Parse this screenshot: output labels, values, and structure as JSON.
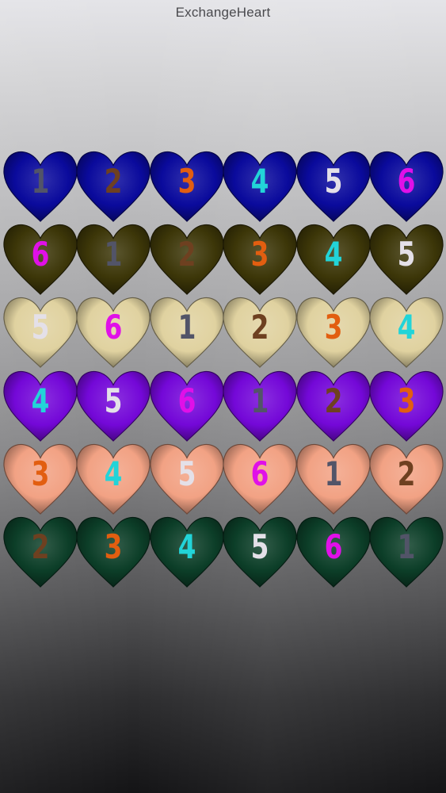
{
  "app": {
    "title": "ExchangeHeart"
  },
  "row_colors": [
    "#0a0a9c",
    "#3c3608",
    "#e0d2a0",
    "#7408d8",
    "#f2a284",
    "#0c3e28"
  ],
  "number_colors": {
    "1": "#525468",
    "2": "#6e4020",
    "3": "#e25e10",
    "4": "#22d4d8",
    "5": "#e4e0e8",
    "6": "#e010e8"
  },
  "grid": [
    [
      "1",
      "2",
      "3",
      "4",
      "5",
      "6"
    ],
    [
      "6",
      "1",
      "2",
      "3",
      "4",
      "5"
    ],
    [
      "5",
      "6",
      "1",
      "2",
      "3",
      "4"
    ],
    [
      "4",
      "5",
      "6",
      "1",
      "2",
      "3"
    ],
    [
      "3",
      "4",
      "5",
      "6",
      "1",
      "2"
    ],
    [
      "2",
      "3",
      "4",
      "5",
      "6",
      "1"
    ]
  ]
}
